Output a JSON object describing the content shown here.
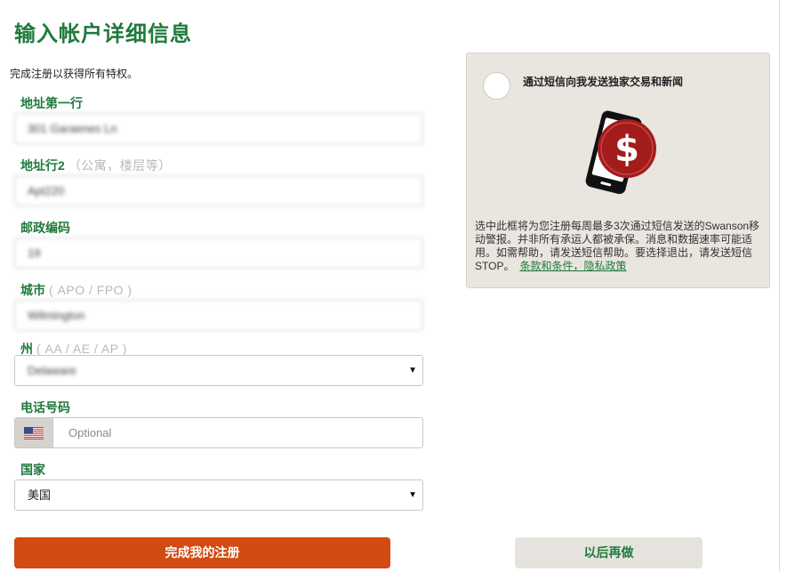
{
  "page": {
    "title": "输入帐户详细信息",
    "subtitle": "完成注册以获得所有特权。"
  },
  "form": {
    "address1": {
      "label": "地址第一行",
      "value": "301 Garaenes Ln"
    },
    "address2": {
      "label": "地址行2",
      "hint": "（公寓，楼层等）",
      "value": "Apt220"
    },
    "zip": {
      "label": "邮政编码",
      "value": "19"
    },
    "city": {
      "label": "城市",
      "hint": "( APO / FPO )",
      "value": "Wilmington"
    },
    "state": {
      "label": "州",
      "hint": "( AA / AE / AP )",
      "value": "Delaware"
    },
    "phone": {
      "label": "电话号码",
      "placeholder": "Optional",
      "country_icon": "us-flag-icon"
    },
    "country": {
      "label": "国家",
      "value": "美国"
    }
  },
  "sms": {
    "label": "通过短信向我发送独家交易和新闻",
    "icon": "phone-dollar-icon",
    "text": "选中此框将为您注册每周最多3次通过短信发送的Swanson移动警报。并非所有承运人都被承保。消息和数据速率可能适用。如需帮助，请发送短信帮助。要选择退出，请发送短信STOP。",
    "link": "条款和条件，隐私政策"
  },
  "buttons": {
    "submit": "完成我的注册",
    "later": "以后再做"
  },
  "colors": {
    "brand_green": "#1f7a3c",
    "primary_button": "#d24b12",
    "panel_bg": "#e9e5df"
  }
}
